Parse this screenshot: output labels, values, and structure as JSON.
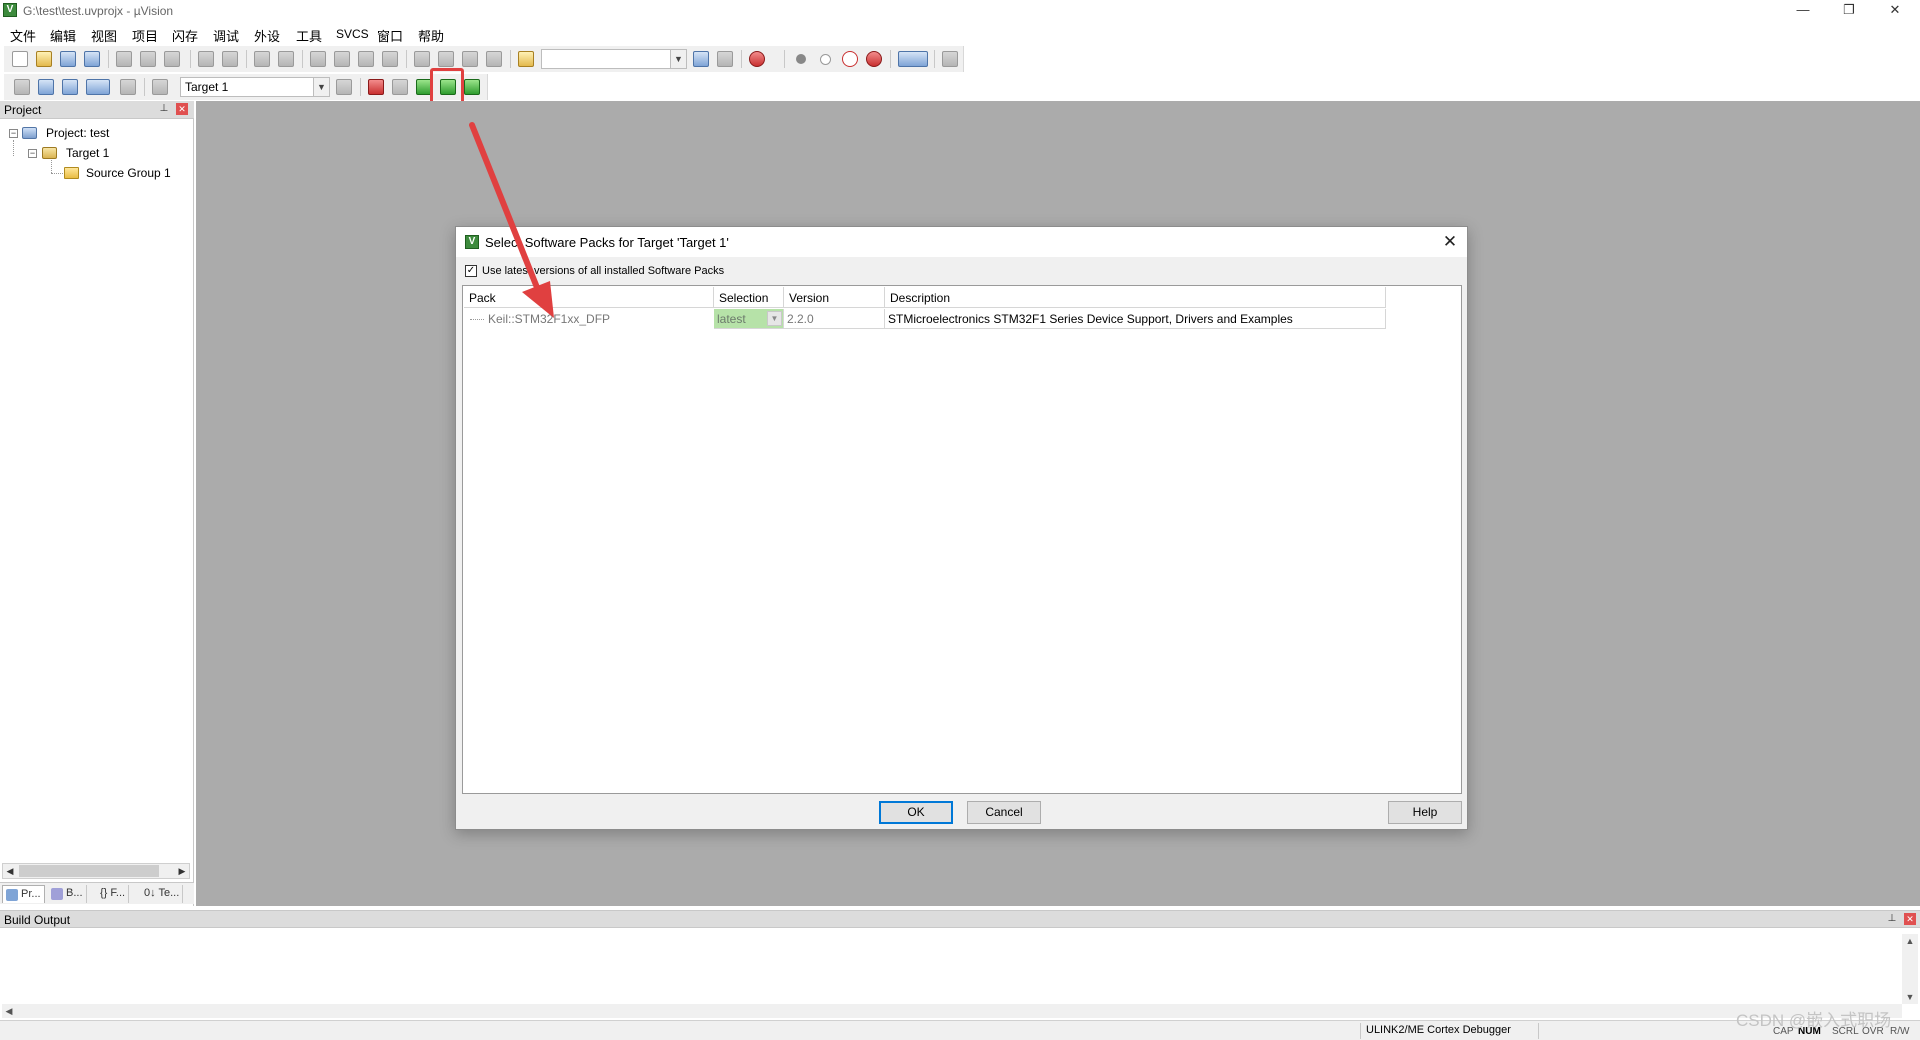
{
  "window": {
    "title": "G:\\test\\test.uvprojx - µVision",
    "app_icon": "keil-uvision-icon",
    "controls": {
      "minimize": "—",
      "restore": "❐",
      "close": "✕"
    }
  },
  "menu": {
    "items": [
      "文件",
      "编辑",
      "视图",
      "项目",
      "闪存",
      "调试",
      "外设",
      "工具",
      "SVCS",
      "窗口",
      "帮助"
    ]
  },
  "toolbar2": {
    "target_select": "Target 1"
  },
  "project_panel": {
    "title": "Project",
    "tree": {
      "project": "Project: test",
      "target": "Target 1",
      "group": "Source Group 1"
    },
    "tabs": [
      "Pr...",
      "B...",
      "{} F...",
      "0↓ Te..."
    ]
  },
  "dialog": {
    "title": "Select Software Packs for Target 'Target 1'",
    "use_latest_label": "Use latest versions of all installed Software Packs",
    "use_latest_checked": true,
    "columns": [
      "Pack",
      "Selection",
      "Version",
      "Description"
    ],
    "rows": [
      {
        "pack": "Keil::STM32F1xx_DFP",
        "selection": "latest",
        "version": "2.2.0",
        "description": "STMicroelectronics STM32F1 Series Device Support, Drivers and Examples"
      }
    ],
    "buttons": {
      "ok": "OK",
      "cancel": "Cancel",
      "help": "Help"
    }
  },
  "build_output": {
    "title": "Build Output"
  },
  "statusbar": {
    "debugger": "ULINK2/ME Cortex Debugger",
    "indicators": [
      "CAP",
      "NUM",
      "SCRL",
      "OVR",
      "R/W"
    ],
    "active_indicator": "NUM"
  },
  "watermark": "CSDN @嵌入式职场",
  "colors": {
    "editor_bg": "#ababab",
    "highlight": "#e04040",
    "selection_green": "#b6e2a8",
    "dialog_bg": "#f0f0f0"
  }
}
